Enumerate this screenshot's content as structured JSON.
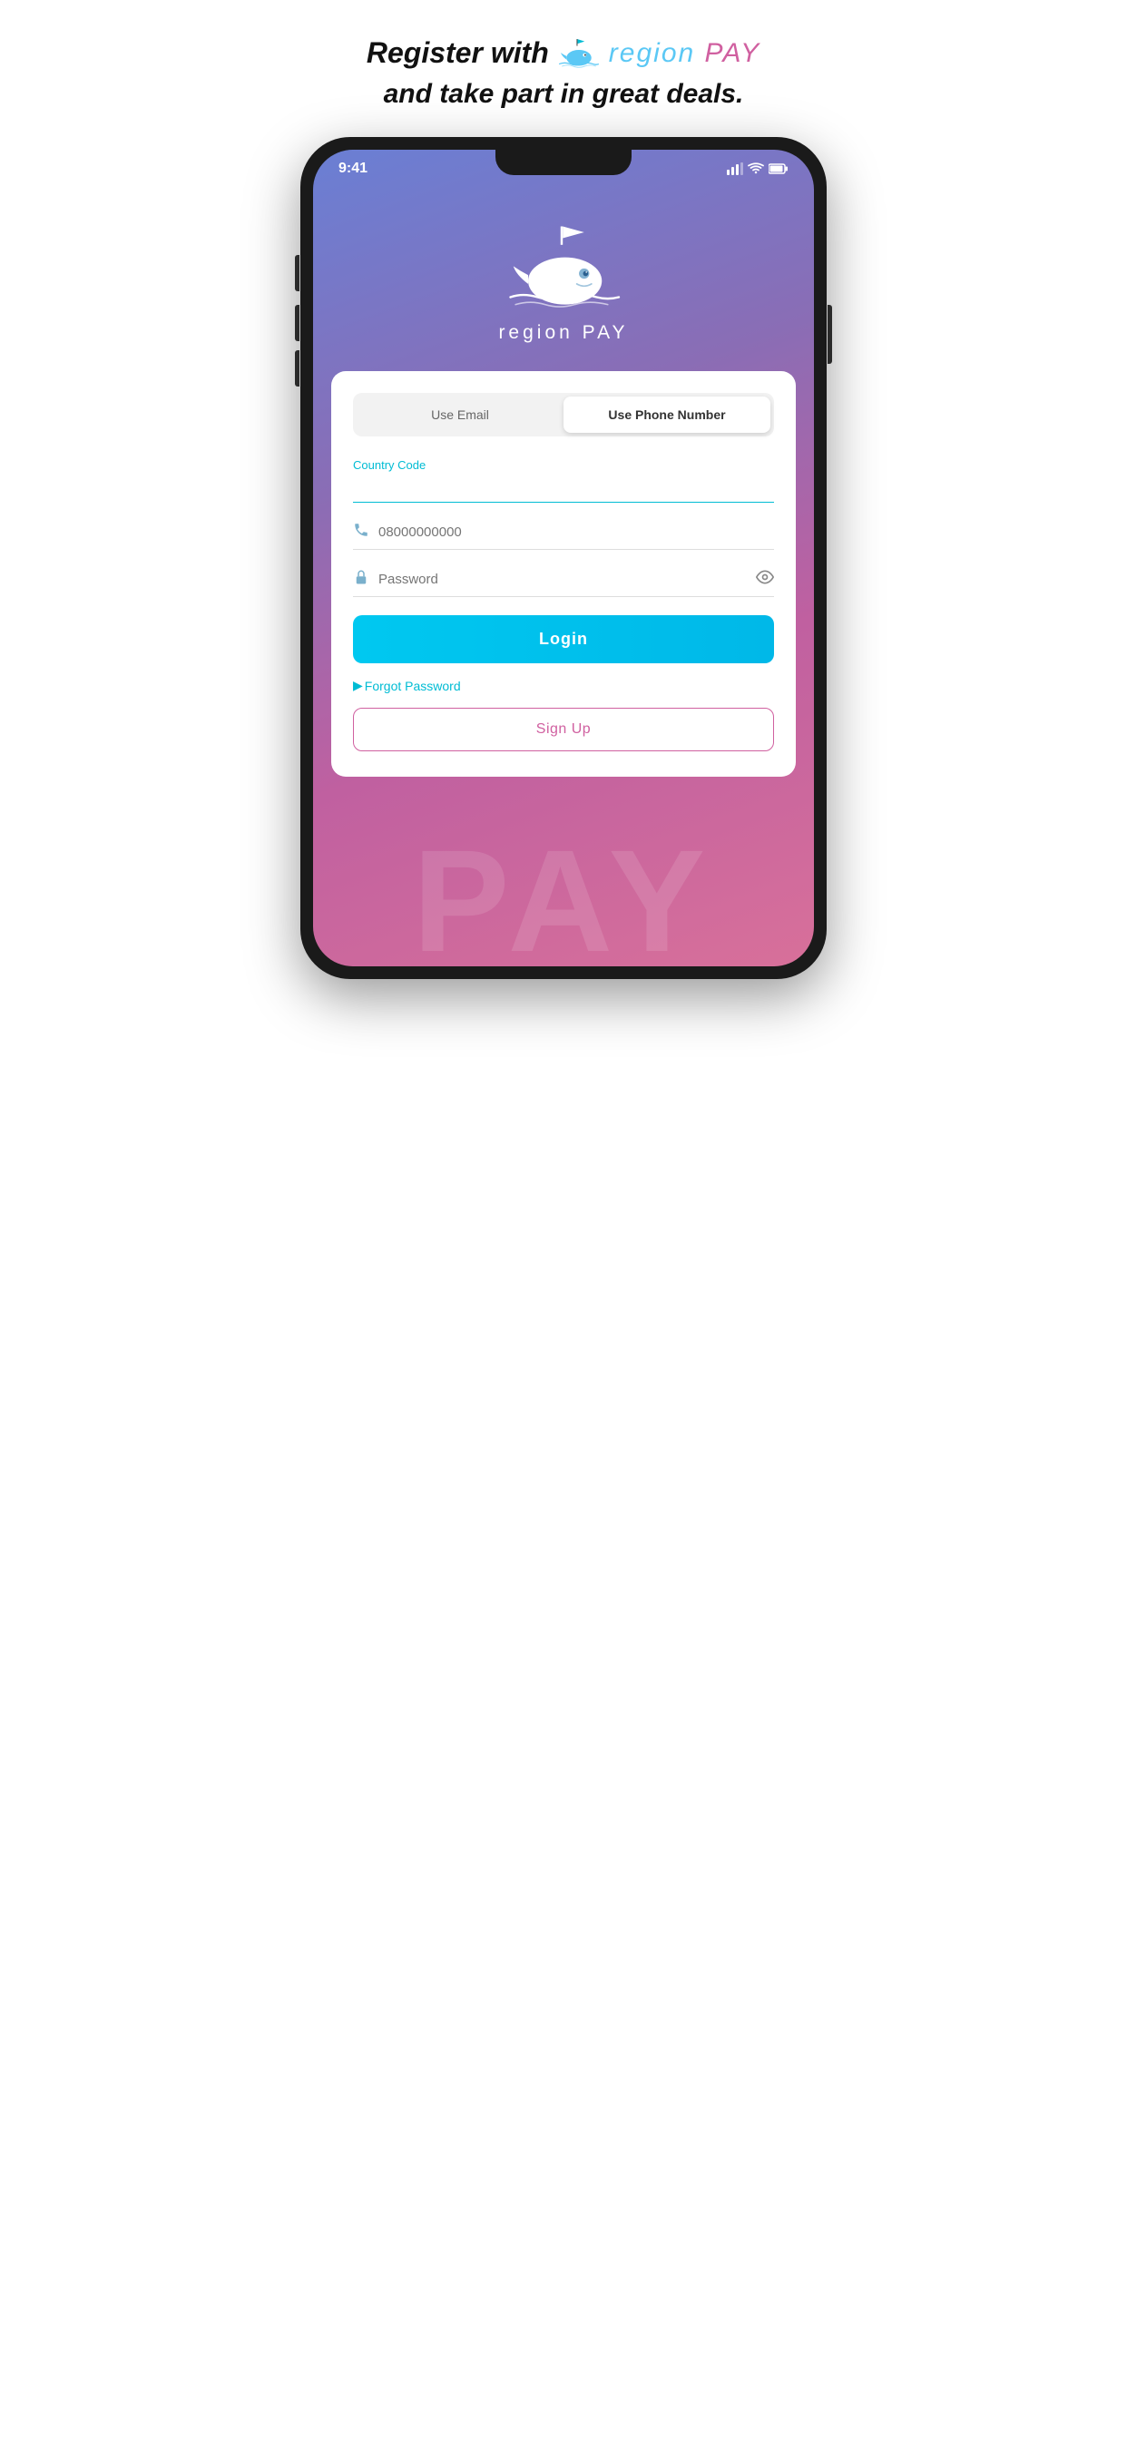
{
  "header": {
    "line1_prefix": "Register with",
    "line2": "and take part in great deals.",
    "logo": {
      "region": "region",
      "pay": "PAY"
    }
  },
  "status_bar": {
    "time": "9:41",
    "signal": "▌▌▌",
    "wifi": "WiFi",
    "battery": "Battery"
  },
  "app": {
    "name": "region PAY"
  },
  "toggle": {
    "email_label": "Use Email",
    "phone_label": "Use Phone Number"
  },
  "form": {
    "country_code_label": "Country Code",
    "country_code_placeholder": "",
    "phone_placeholder": "08000000000",
    "password_placeholder": "Password",
    "login_button": "Login",
    "forgot_password": "Forgot Password",
    "signup_button": "Sign Up"
  },
  "bg_text": "PAY"
}
